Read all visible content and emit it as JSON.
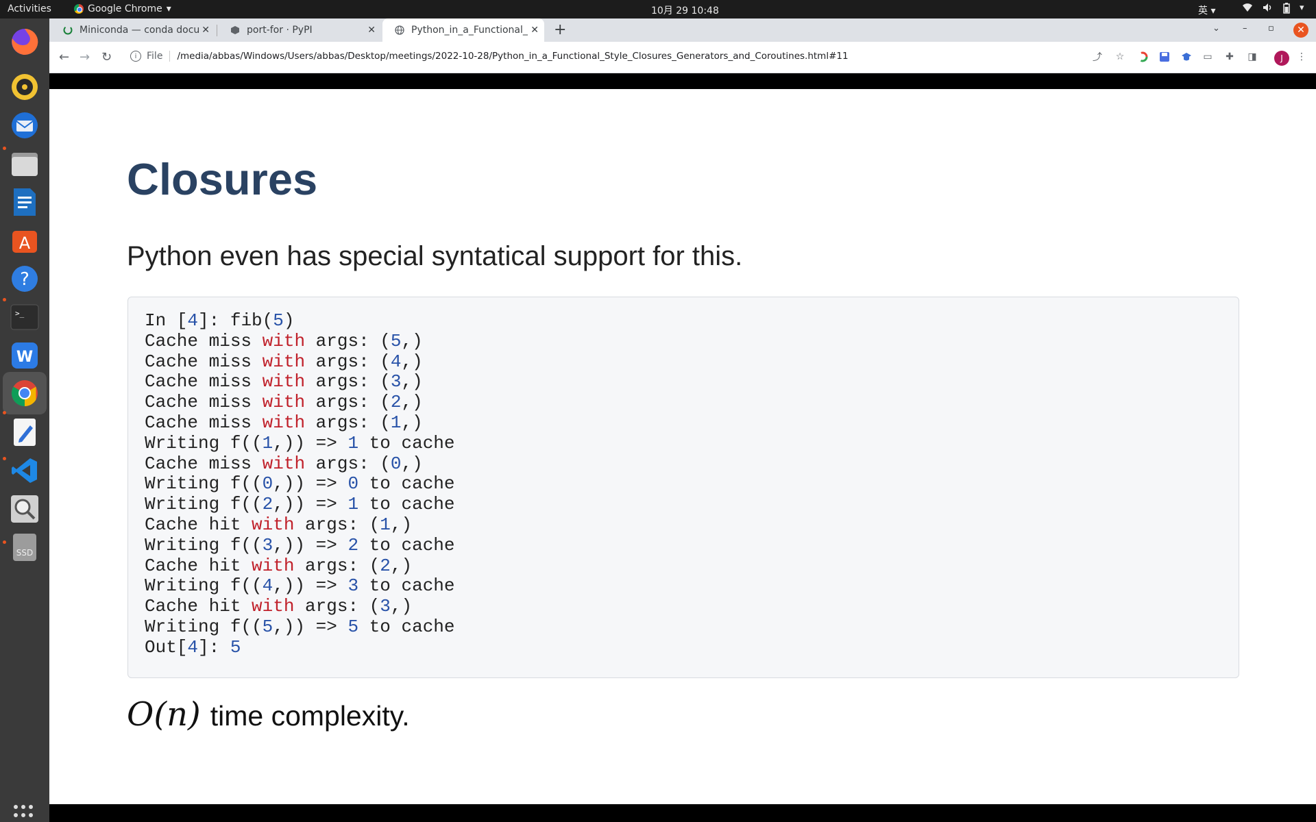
{
  "topbar": {
    "activities": "Activities",
    "app_name": "Google Chrome",
    "clock": "10月 29  10:48",
    "ime": "英"
  },
  "dock": {
    "apps": [
      "firefox",
      "rhythmbox",
      "thunderbird",
      "files",
      "libreoffice-writer",
      "app-center",
      "help",
      "terminal",
      "wps",
      "chrome",
      "text-editor",
      "vscode",
      "magnifier",
      "ssd-drive"
    ],
    "ssd_label": "SSD"
  },
  "browser": {
    "tabs": [
      {
        "title": "Miniconda — conda docu"
      },
      {
        "title": "port-for · PyPI"
      },
      {
        "title": "Python_in_a_Functional_S"
      }
    ],
    "address": {
      "scheme_label": "File",
      "url": "/media/abbas/Windows/Users/abbas/Desktop/meetings/2022-10-28/Python_in_a_Functional_Style_Closures_Generators_and_Coroutines.html#11"
    },
    "profile_initial": "J"
  },
  "slide": {
    "title": "Closures",
    "subtitle": "Python even has special syntatical support for this.",
    "code_lines": [
      [
        {
          "t": "In [",
          "c": ""
        },
        {
          "t": "4",
          "c": "num"
        },
        {
          "t": "]: fib(",
          "c": ""
        },
        {
          "t": "5",
          "c": "num"
        },
        {
          "t": ")",
          "c": ""
        }
      ],
      [
        {
          "t": "Cache miss ",
          "c": ""
        },
        {
          "t": "with",
          "c": "kw"
        },
        {
          "t": " args: (",
          "c": ""
        },
        {
          "t": "5",
          "c": "num"
        },
        {
          "t": ",)",
          "c": ""
        }
      ],
      [
        {
          "t": "Cache miss ",
          "c": ""
        },
        {
          "t": "with",
          "c": "kw"
        },
        {
          "t": " args: (",
          "c": ""
        },
        {
          "t": "4",
          "c": "num"
        },
        {
          "t": ",)",
          "c": ""
        }
      ],
      [
        {
          "t": "Cache miss ",
          "c": ""
        },
        {
          "t": "with",
          "c": "kw"
        },
        {
          "t": " args: (",
          "c": ""
        },
        {
          "t": "3",
          "c": "num"
        },
        {
          "t": ",)",
          "c": ""
        }
      ],
      [
        {
          "t": "Cache miss ",
          "c": ""
        },
        {
          "t": "with",
          "c": "kw"
        },
        {
          "t": " args: (",
          "c": ""
        },
        {
          "t": "2",
          "c": "num"
        },
        {
          "t": ",)",
          "c": ""
        }
      ],
      [
        {
          "t": "Cache miss ",
          "c": ""
        },
        {
          "t": "with",
          "c": "kw"
        },
        {
          "t": " args: (",
          "c": ""
        },
        {
          "t": "1",
          "c": "num"
        },
        {
          "t": ",)",
          "c": ""
        }
      ],
      [
        {
          "t": "Writing f((",
          "c": ""
        },
        {
          "t": "1",
          "c": "num"
        },
        {
          "t": ",)) => ",
          "c": ""
        },
        {
          "t": "1",
          "c": "num"
        },
        {
          "t": " to cache",
          "c": ""
        }
      ],
      [
        {
          "t": "Cache miss ",
          "c": ""
        },
        {
          "t": "with",
          "c": "kw"
        },
        {
          "t": " args: (",
          "c": ""
        },
        {
          "t": "0",
          "c": "num"
        },
        {
          "t": ",)",
          "c": ""
        }
      ],
      [
        {
          "t": "Writing f((",
          "c": ""
        },
        {
          "t": "0",
          "c": "num"
        },
        {
          "t": ",)) => ",
          "c": ""
        },
        {
          "t": "0",
          "c": "num"
        },
        {
          "t": " to cache",
          "c": ""
        }
      ],
      [
        {
          "t": "Writing f((",
          "c": ""
        },
        {
          "t": "2",
          "c": "num"
        },
        {
          "t": ",)) => ",
          "c": ""
        },
        {
          "t": "1",
          "c": "num"
        },
        {
          "t": " to cache",
          "c": ""
        }
      ],
      [
        {
          "t": "Cache hit ",
          "c": ""
        },
        {
          "t": "with",
          "c": "kw"
        },
        {
          "t": " args: (",
          "c": ""
        },
        {
          "t": "1",
          "c": "num"
        },
        {
          "t": ",)",
          "c": ""
        }
      ],
      [
        {
          "t": "Writing f((",
          "c": ""
        },
        {
          "t": "3",
          "c": "num"
        },
        {
          "t": ",)) => ",
          "c": ""
        },
        {
          "t": "2",
          "c": "num"
        },
        {
          "t": " to cache",
          "c": ""
        }
      ],
      [
        {
          "t": "Cache hit ",
          "c": ""
        },
        {
          "t": "with",
          "c": "kw"
        },
        {
          "t": " args: (",
          "c": ""
        },
        {
          "t": "2",
          "c": "num"
        },
        {
          "t": ",)",
          "c": ""
        }
      ],
      [
        {
          "t": "Writing f((",
          "c": ""
        },
        {
          "t": "4",
          "c": "num"
        },
        {
          "t": ",)) => ",
          "c": ""
        },
        {
          "t": "3",
          "c": "num"
        },
        {
          "t": " to cache",
          "c": ""
        }
      ],
      [
        {
          "t": "Cache hit ",
          "c": ""
        },
        {
          "t": "with",
          "c": "kw"
        },
        {
          "t": " args: (",
          "c": ""
        },
        {
          "t": "3",
          "c": "num"
        },
        {
          "t": ",)",
          "c": ""
        }
      ],
      [
        {
          "t": "Writing f((",
          "c": ""
        },
        {
          "t": "5",
          "c": "num"
        },
        {
          "t": ",)) => ",
          "c": ""
        },
        {
          "t": "5",
          "c": "num"
        },
        {
          "t": " to cache",
          "c": ""
        }
      ],
      [
        {
          "t": "Out[",
          "c": ""
        },
        {
          "t": "4",
          "c": "num"
        },
        {
          "t": "]: ",
          "c": ""
        },
        {
          "t": "5",
          "c": "num"
        }
      ]
    ],
    "complexity_math": "O(n)",
    "complexity_text": "time complexity."
  },
  "colors": {
    "title": "#2a4262",
    "keyword": "#c0202a",
    "number": "#2852a8",
    "accent_close": "#e95420"
  }
}
